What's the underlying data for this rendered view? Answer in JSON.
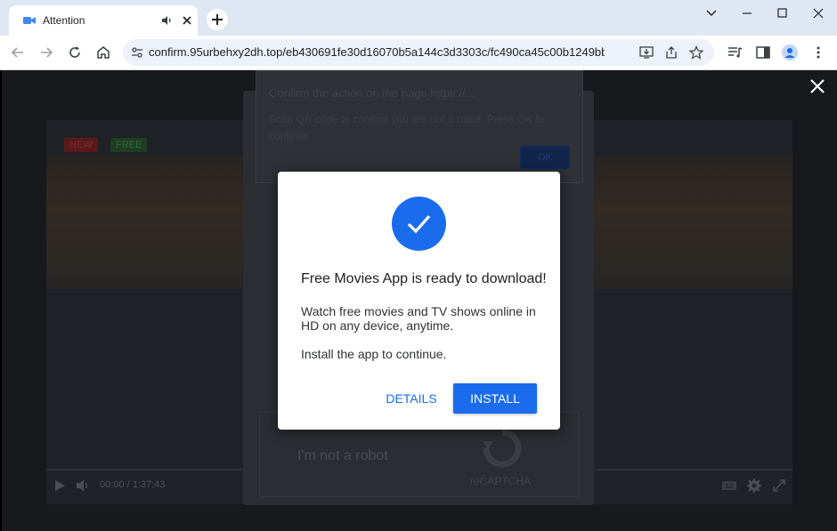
{
  "tab": {
    "title": "Attention",
    "favicon": "video-camera-icon",
    "audio_icon": "speaker-icon"
  },
  "window_controls": [
    "chevron-down-icon",
    "minimize-icon",
    "maximize-icon",
    "close-icon"
  ],
  "address_bar": {
    "url": "confirm.95urbehxy2dh.top/eb430691fe30d16070b5a144c3d3303c/fc490ca45c00b1249bbe3554a4f..."
  },
  "browser_dialog": {
    "title": "Confirm the action on the page https://...",
    "body": "Scan QR code to confirm you are not a robot. Press OK to continue",
    "ok_label": "OK"
  },
  "player": {
    "badge_new": "NEW",
    "badge_free": "FREE",
    "time": "00:00 / 1:37:43"
  },
  "captcha": {
    "text": "I'm not a robot",
    "label": "reCAPTCHA"
  },
  "modal": {
    "title": "Free Movies App is ready to download!",
    "body": "Watch free movies and TV shows online in HD on any device, anytime.",
    "body2": "Install the app to continue.",
    "details_label": "DETAILS",
    "install_label": "INSTALL"
  },
  "colors": {
    "accent": "#1a6cec",
    "tabbar": "#dfe7f2"
  }
}
